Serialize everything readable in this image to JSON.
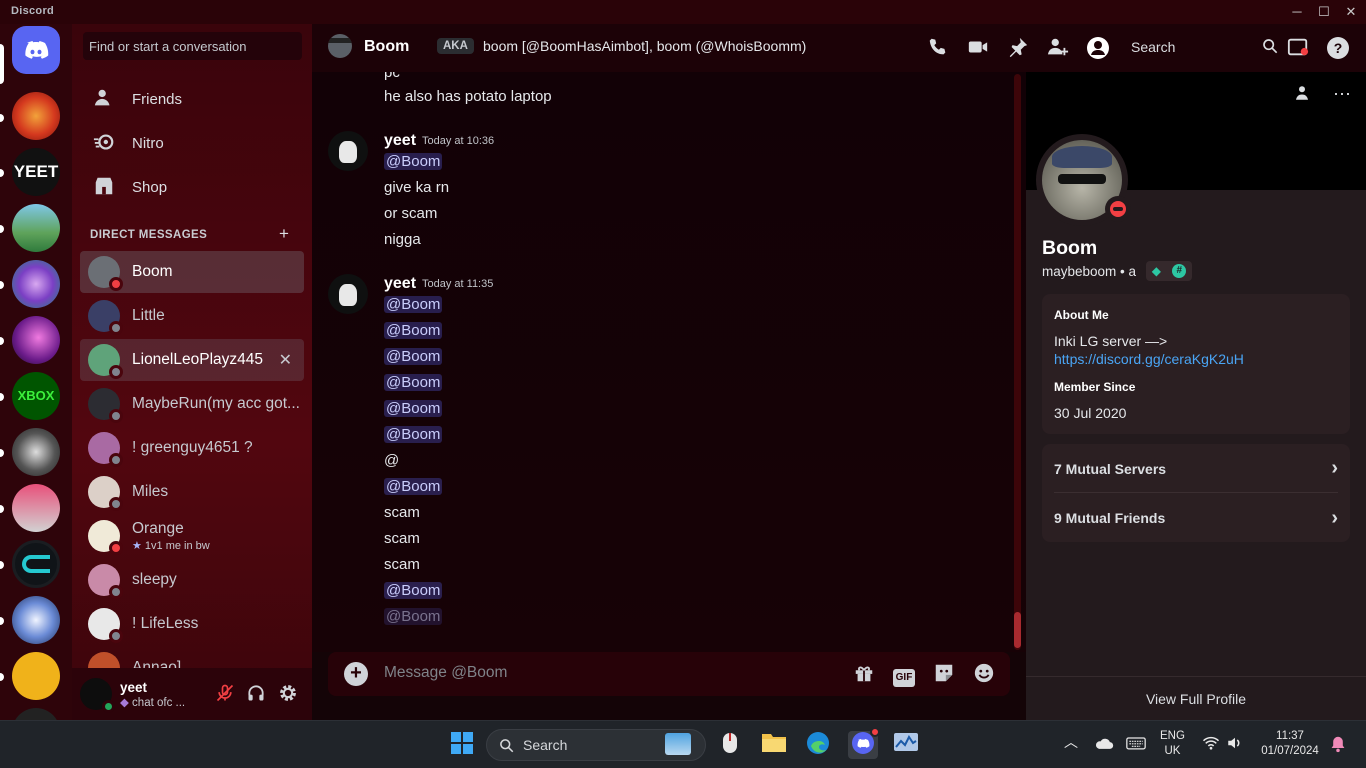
{
  "app": {
    "title": "Discord"
  },
  "window": {
    "minimize": "─",
    "maximize": "☐",
    "close": "✕"
  },
  "dm": {
    "search_placeholder": "Find or start a conversation",
    "nav": [
      {
        "label": "Friends",
        "icon": "friends-icon"
      },
      {
        "label": "Nitro",
        "icon": "nitro-icon"
      },
      {
        "label": "Shop",
        "icon": "shop-icon"
      }
    ],
    "header": "DIRECT MESSAGES",
    "add": "+",
    "items": [
      {
        "name": "Boom",
        "status": "dnd"
      },
      {
        "name": "Little",
        "status": "offline"
      },
      {
        "name": "LionelLeoPlayz445",
        "status": "offline"
      },
      {
        "name": "MaybeRun(my acc got...",
        "status": "offline"
      },
      {
        "name": "! greenguy4651 ?",
        "status": "offline"
      },
      {
        "name": "Miles",
        "status": "offline"
      },
      {
        "name": "Orange",
        "status": "dnd",
        "sub": "1v1 me in bw"
      },
      {
        "name": "sleepy",
        "status": "offline"
      },
      {
        "name": "! LifeLess",
        "status": "offline"
      },
      {
        "name": "Annao]",
        "status": "offline"
      }
    ],
    "close": "✕"
  },
  "user": {
    "name": "yeet",
    "status": "chat ofc ..."
  },
  "chat": {
    "title": "Boom",
    "aka_label": "AKA",
    "aka_text": "boom [@BoomHasAimbot], boom (@WhoisBoomm)",
    "search": "Search",
    "composer_placeholder": "Message @Boom",
    "composer_gif": "GIF",
    "messages_top": [
      "pc",
      "he also has potato laptop"
    ],
    "groups": [
      {
        "author": "yeet",
        "time": "Today at 10:36",
        "lines": [
          "@Boom",
          "give ka rn",
          "or scam",
          "nigga"
        ]
      },
      {
        "author": "yeet",
        "time": "Today at 11:35",
        "lines": [
          "@Boom",
          "@Boom",
          "@Boom",
          "@Boom",
          "@Boom",
          "@Boom",
          "@",
          "@Boom",
          "scam",
          "scam",
          "scam",
          "@Boom",
          "@Boom"
        ]
      }
    ]
  },
  "profile": {
    "name": "Boom",
    "username": "maybeboom • a",
    "about_title": "About Me",
    "about_text": "Inki LG server —>",
    "about_link": "https://discord.gg/ceraKgK2uH",
    "member_since_title": "Member Since",
    "member_since": "30 Jul 2020",
    "mutual_servers": "7 Mutual Servers",
    "mutual_friends": "9 Mutual Friends",
    "view_full": "View Full Profile"
  },
  "taskbar": {
    "search": "Search",
    "lang": "ENG",
    "region": "UK",
    "time": "11:37",
    "date": "01/07/2024"
  },
  "colors": {
    "accent": "#5865f2",
    "dnd": "#f23f43",
    "online": "#23a55a",
    "link": "#4aa5f5"
  }
}
